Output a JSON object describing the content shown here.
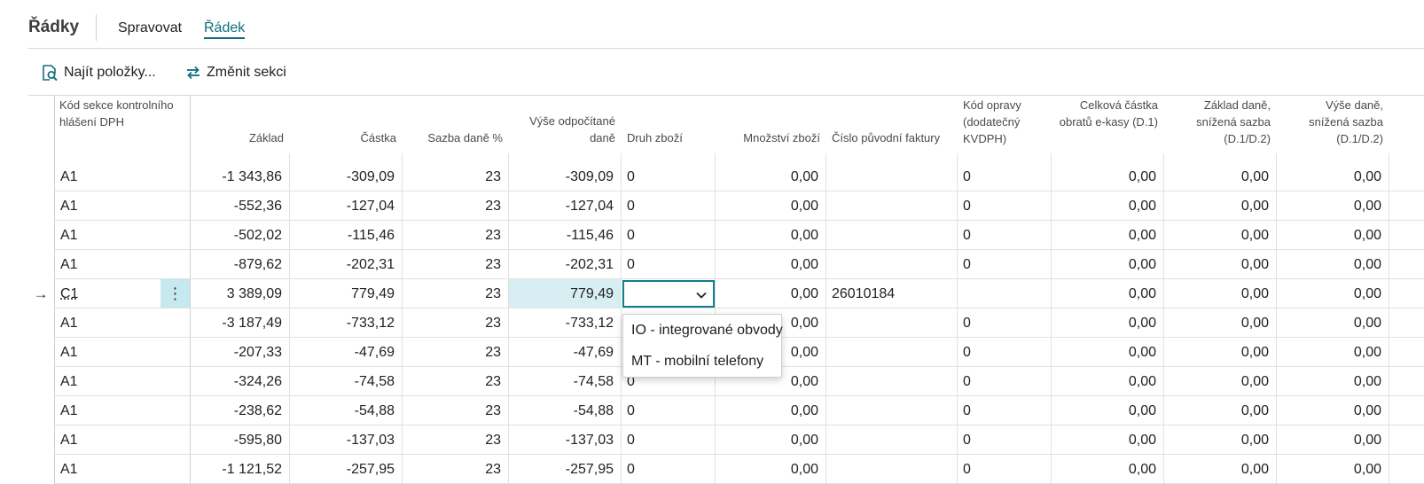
{
  "header": {
    "title": "Řádky",
    "tabs": [
      {
        "label": "Spravovat",
        "active": false
      },
      {
        "label": "Řádek",
        "active": true
      }
    ]
  },
  "toolbar": {
    "find_entries": "Najít položky...",
    "change_section": "Změnit sekci"
  },
  "table": {
    "columns": [
      "Kód sekce kontrolního hlášení DPH",
      "Základ",
      "Částka",
      "Sazba daně %",
      "Výše odpočítané daně",
      "Druh zboží",
      "Množství zboží",
      "Číslo původní faktury",
      "Kód opravy (dodatečný KVDPH)",
      "Celková částka obratů e-kasy (D.1)",
      "Základ daně, snížená sazba (D.1/D.2)",
      "Výše daně, snížená sazba (D.1/D.2)"
    ],
    "rows": [
      {
        "code": "A1",
        "base": "-1 343,86",
        "amount": "-309,09",
        "rate": "23",
        "deducted": "-309,09",
        "goods": "0",
        "qty": "0,00",
        "invoice": "",
        "correction": "0",
        "ekasa": "0,00",
        "base_red": "0,00",
        "tax_red": "0,00"
      },
      {
        "code": "A1",
        "base": "-552,36",
        "amount": "-127,04",
        "rate": "23",
        "deducted": "-127,04",
        "goods": "0",
        "qty": "0,00",
        "invoice": "",
        "correction": "0",
        "ekasa": "0,00",
        "base_red": "0,00",
        "tax_red": "0,00"
      },
      {
        "code": "A1",
        "base": "-502,02",
        "amount": "-115,46",
        "rate": "23",
        "deducted": "-115,46",
        "goods": "0",
        "qty": "0,00",
        "invoice": "",
        "correction": "0",
        "ekasa": "0,00",
        "base_red": "0,00",
        "tax_red": "0,00"
      },
      {
        "code": "A1",
        "base": "-879,62",
        "amount": "-202,31",
        "rate": "23",
        "deducted": "-202,31",
        "goods": "0",
        "qty": "0,00",
        "invoice": "",
        "correction": "0",
        "ekasa": "0,00",
        "base_red": "0,00",
        "tax_red": "0,00"
      },
      {
        "code": "C1",
        "base": "3 389,09",
        "amount": "779,49",
        "rate": "23",
        "deducted": "779,49",
        "goods": "",
        "qty": "0,00",
        "invoice": "26010184",
        "correction": "",
        "ekasa": "0,00",
        "base_red": "0,00",
        "tax_red": "0,00",
        "active": true
      },
      {
        "code": "A1",
        "base": "-3 187,49",
        "amount": "-733,12",
        "rate": "23",
        "deducted": "-733,12",
        "goods": "",
        "qty": "0,00",
        "invoice": "",
        "correction": "0",
        "ekasa": "0,00",
        "base_red": "0,00",
        "tax_red": "0,00"
      },
      {
        "code": "A1",
        "base": "-207,33",
        "amount": "-47,69",
        "rate": "23",
        "deducted": "-47,69",
        "goods": "",
        "qty": "0,00",
        "invoice": "",
        "correction": "0",
        "ekasa": "0,00",
        "base_red": "0,00",
        "tax_red": "0,00"
      },
      {
        "code": "A1",
        "base": "-324,26",
        "amount": "-74,58",
        "rate": "23",
        "deducted": "-74,58",
        "goods": "0",
        "qty": "0,00",
        "invoice": "",
        "correction": "0",
        "ekasa": "0,00",
        "base_red": "0,00",
        "tax_red": "0,00"
      },
      {
        "code": "A1",
        "base": "-238,62",
        "amount": "-54,88",
        "rate": "23",
        "deducted": "-54,88",
        "goods": "0",
        "qty": "0,00",
        "invoice": "",
        "correction": "0",
        "ekasa": "0,00",
        "base_red": "0,00",
        "tax_red": "0,00"
      },
      {
        "code": "A1",
        "base": "-595,80",
        "amount": "-137,03",
        "rate": "23",
        "deducted": "-137,03",
        "goods": "0",
        "qty": "0,00",
        "invoice": "",
        "correction": "0",
        "ekasa": "0,00",
        "base_red": "0,00",
        "tax_red": "0,00"
      },
      {
        "code": "A1",
        "base": "-1 121,52",
        "amount": "-257,95",
        "rate": "23",
        "deducted": "-257,95",
        "goods": "0",
        "qty": "0,00",
        "invoice": "",
        "correction": "0",
        "ekasa": "0,00",
        "base_red": "0,00",
        "tax_red": "0,00"
      }
    ]
  },
  "dropdown": {
    "options": [
      "IO - integrované obvody",
      "MT - mobilní telefony"
    ]
  },
  "colors": {
    "accent": "#0f6e7e",
    "highlight": "#d7eff3"
  },
  "icons": {
    "find": "find-entries-icon",
    "change": "swap-arrows-icon",
    "row_menu": "more-vertical-icon",
    "current_row": "arrow-right-icon",
    "select": "chevron-down-icon"
  }
}
